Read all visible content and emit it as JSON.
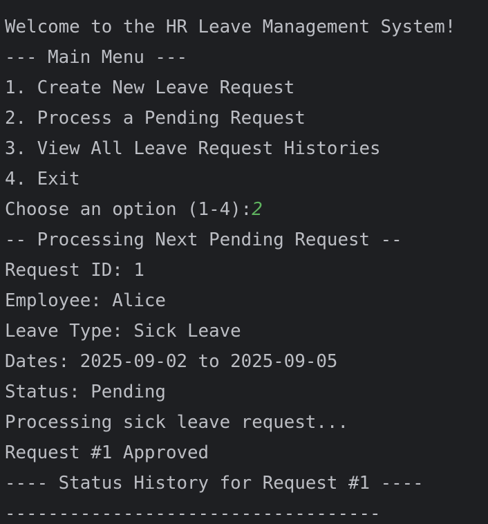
{
  "console": {
    "lines": [
      "Welcome to the HR Leave Management System!",
      "--- Main Menu ---",
      "1. Create New Leave Request",
      "2. Process a Pending Request",
      "3. View All Leave Request Histories",
      "4. Exit",
      "Choose an option (1-4):",
      "-- Processing Next Pending Request --",
      "Request ID: 1",
      "Employee: Alice",
      "Leave Type: Sick Leave",
      "Dates: 2025-09-02 to 2025-09-05",
      "Status: Pending",
      "Processing sick leave request...",
      "Request #1 Approved",
      "---- Status History for Request #1 ----",
      "-----------------------------------"
    ],
    "user_input": "2"
  },
  "colors": {
    "background": "#1e1f22",
    "text": "#bcbec4",
    "user_input": "#5fb35f"
  }
}
